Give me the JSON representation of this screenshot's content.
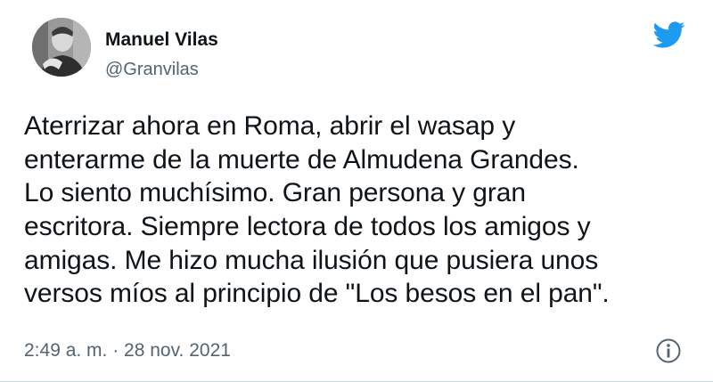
{
  "author": {
    "name": "Manuel Vilas",
    "handle": "@Granvilas",
    "avatar_icon": "person-photo-icon"
  },
  "brand": {
    "icon": "twitter-bird-icon",
    "color": "#1d9bf0"
  },
  "tweet": {
    "lines": [
      "Aterrizar ahora en Roma, abrir el wasap y",
      "enterarme de la muerte de Almudena Grandes.",
      "Lo siento muchísimo. Gran persona y gran",
      "escritora. Siempre lectora de todos los amigos y",
      "amigas. Me hizo mucha ilusión que pusiera unos",
      "versos míos al principio de \"Los besos en el pan\"."
    ]
  },
  "meta": {
    "timestamp": "2:49 a. m. · 28 nov. 2021",
    "info_icon": "info-icon"
  },
  "colors": {
    "text": "#0f1419",
    "secondary": "#536471",
    "background": "#ffffff"
  }
}
